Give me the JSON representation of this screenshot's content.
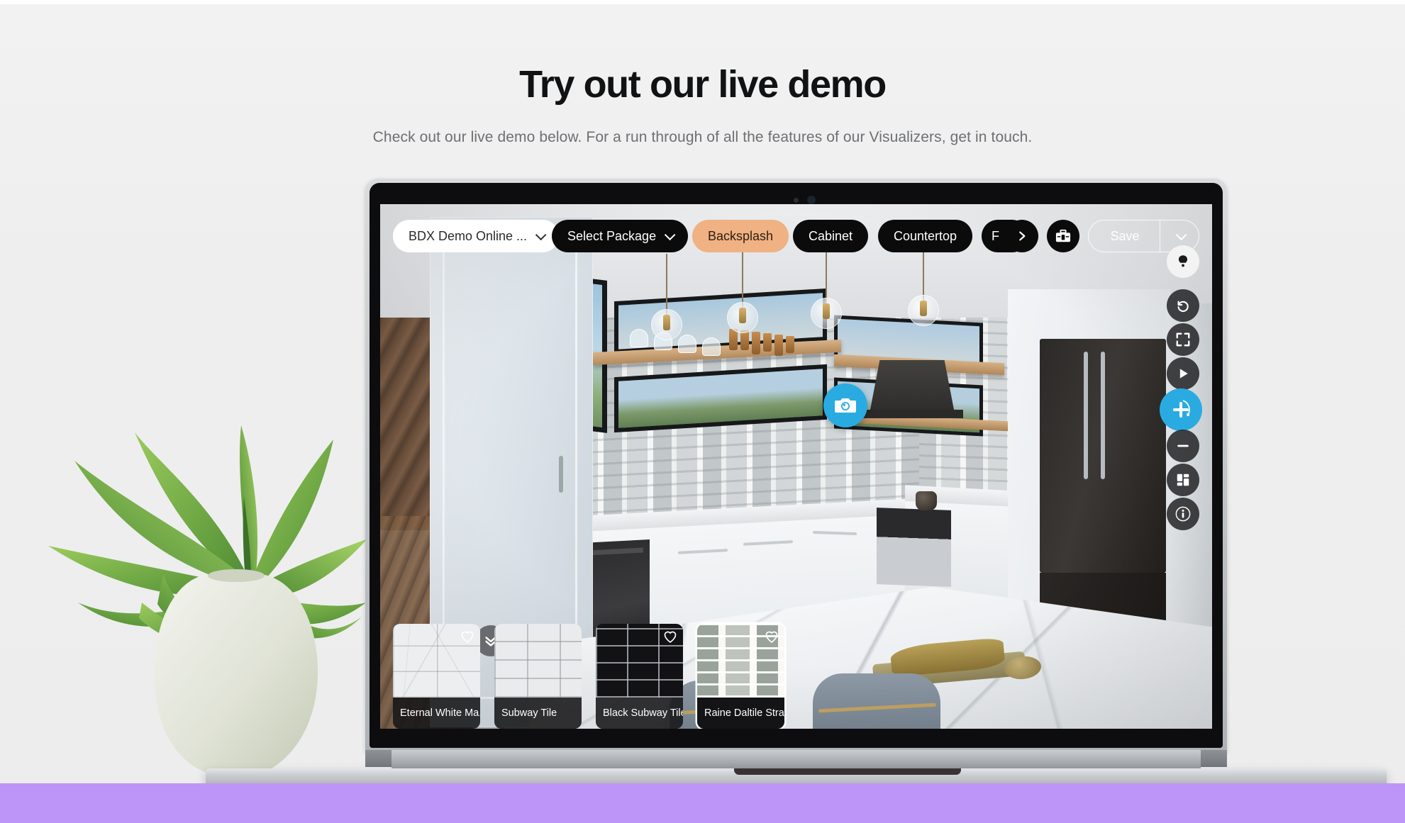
{
  "page": {
    "title": "Try out our live demo",
    "subtitle": "Check out our live demo below. For a run through of all the features of our Visualizers, get in touch.",
    "background_color": "#eeeeee",
    "accent_band_color": "#bd95f8"
  },
  "app": {
    "accent_color": "#29abe2",
    "active_chip_color": "#f0b183",
    "toolbar": {
      "project_selector": {
        "label": "BDX Demo Online ...",
        "icon": "chevron-down-icon"
      },
      "package_selector": {
        "label": "Select Package",
        "icon": "chevron-down-icon"
      },
      "category_chips": [
        {
          "label": "Backsplash",
          "active": true
        },
        {
          "label": "Cabinet",
          "active": false
        },
        {
          "label": "Countertop",
          "active": false
        },
        {
          "label": "F",
          "active": false,
          "truncated": true
        }
      ],
      "next_button_icon": "chevron-right-icon",
      "toolbox_button_icon": "toolbox-icon",
      "save": {
        "label": "Save",
        "caret_icon": "chevron-down-icon"
      }
    },
    "right_rail": [
      {
        "name": "lighting",
        "icon": "lightbulb-icon",
        "style": "light"
      },
      {
        "name": "reset-view",
        "icon": "rotate-ccw-icon",
        "style": "dark"
      },
      {
        "name": "fullscreen",
        "icon": "expand-icon",
        "style": "dark"
      },
      {
        "name": "play-tour",
        "icon": "play-icon",
        "style": "dark"
      },
      {
        "name": "zoom-in",
        "icon": "plus-orbit-icon",
        "style": "accent"
      },
      {
        "name": "zoom-out",
        "icon": "minus-icon",
        "style": "dark"
      },
      {
        "name": "layouts",
        "icon": "grid-layout-icon",
        "style": "dark"
      },
      {
        "name": "info",
        "icon": "info-icon",
        "style": "dark"
      }
    ],
    "bottom_left_controls": [
      {
        "name": "favorites",
        "icon": "heart-icon"
      },
      {
        "name": "search",
        "icon": "magnifier-icon"
      },
      {
        "name": "collapse-tray",
        "icon": "double-chevron-down-icon"
      }
    ],
    "camera_fab": {
      "icon": "camera-icon"
    },
    "swatches": [
      {
        "name": "Eternal White Ma...",
        "texture": "tex-marble",
        "selected": false,
        "favorited": false,
        "heart_visible": true
      },
      {
        "name": "Subway Tile",
        "texture": "tex-subway",
        "selected": false,
        "favorited": false,
        "heart_visible": false
      },
      {
        "name": "Black Subway Tile",
        "texture": "tex-subway-dark",
        "selected": false,
        "favorited": false,
        "heart_visible": true
      },
      {
        "name": "Raine Daltile Stra...",
        "texture": "tex-raine",
        "selected": true,
        "favorited": false,
        "heart_visible": true
      }
    ]
  },
  "decor": {
    "plant": {
      "name": "potted-plant",
      "pot_color": "#dfe2d6",
      "leaf_color": "#7ab648"
    }
  }
}
